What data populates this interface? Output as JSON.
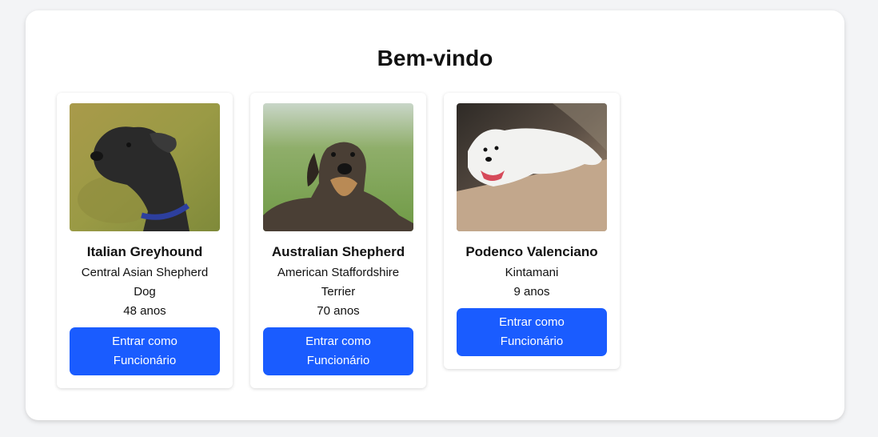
{
  "header": {
    "title": "Bem-vindo"
  },
  "accent_color": "#1a5cff",
  "cards": [
    {
      "image_icon": "dog-photo-black-terrier",
      "name": "Italian Greyhound",
      "breed": "Central Asian Shepherd Dog",
      "age": "48 anos",
      "button_label": "Entrar como Funcionário"
    },
    {
      "image_icon": "dog-photo-wirehaired-dachshund",
      "name": "Australian Shepherd",
      "breed": "American Staffordshire Terrier",
      "age": "70 anos",
      "button_label": "Entrar como Funcionário"
    },
    {
      "image_icon": "dog-photo-white-samoyed",
      "name": "Podenco Valenciano",
      "breed": "Kintamani",
      "age": "9 anos",
      "button_label": "Entrar como Funcionário"
    }
  ]
}
